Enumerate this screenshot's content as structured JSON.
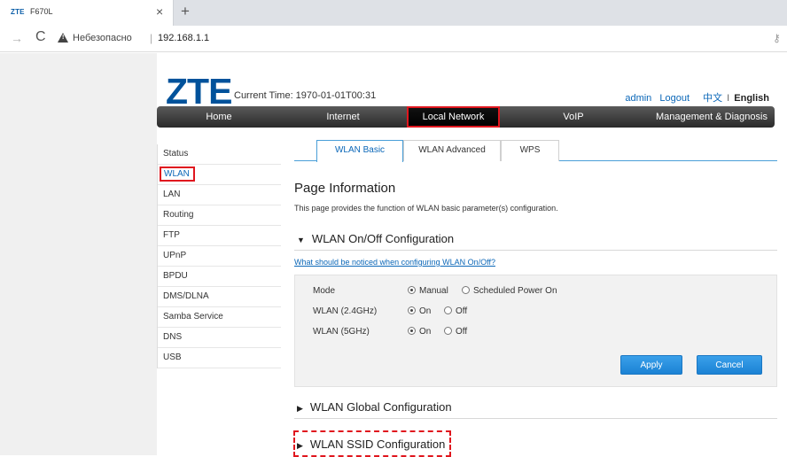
{
  "browser": {
    "tab_logo": "ZTE",
    "tab_title": "F670L",
    "tab_close": "×",
    "new_tab": "+",
    "back": "→",
    "reload": "C",
    "warning_label": "Небезопасно",
    "separator": "|",
    "url": "192.168.1.1"
  },
  "header": {
    "logo": "ZTE",
    "current_time": "Current Time: 1970-01-01T00:31",
    "user": "admin",
    "logout": "Logout",
    "lang_cn": "中文",
    "lang_sep": "I",
    "lang_en": "English"
  },
  "mainnav": [
    "Home",
    "Internet",
    "Local Network",
    "VoIP",
    "Management & Diagnosis"
  ],
  "sidebar": {
    "items": [
      "Status",
      "WLAN",
      "LAN",
      "Routing",
      "FTP",
      "UPnP",
      "BPDU",
      "DMS/DLNA",
      "Samba Service",
      "DNS",
      "USB"
    ],
    "active": "WLAN"
  },
  "tabs": [
    "WLAN Basic",
    "WLAN Advanced",
    "WPS"
  ],
  "page_info": {
    "title": "Page Information",
    "description": "This page provides the function of WLAN basic parameter(s) configuration."
  },
  "onoff": {
    "title": "WLAN On/Off Configuration",
    "notice_link": "What should be noticed when configuring WLAN On/Off?",
    "rows": [
      {
        "label": "Mode",
        "opt1": "Manual",
        "opt2": "Scheduled Power On"
      },
      {
        "label": "WLAN (2.4GHz)",
        "opt1": "On",
        "opt2": "Off"
      },
      {
        "label": "WLAN (5GHz)",
        "opt1": "On",
        "opt2": "Off"
      }
    ],
    "apply": "Apply",
    "cancel": "Cancel"
  },
  "sections": {
    "global": "WLAN Global Configuration",
    "ssid": "WLAN SSID Configuration"
  },
  "colors": {
    "accent": "#0b67b8",
    "highlight": "#e0161e",
    "nav_bg": "#2a2a2a"
  }
}
